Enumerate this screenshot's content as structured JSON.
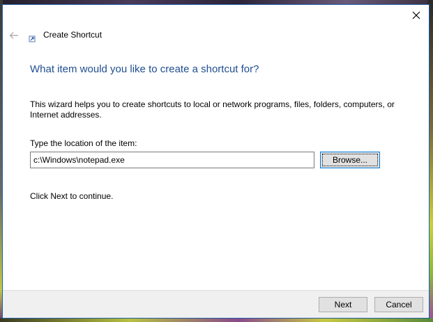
{
  "window": {
    "title": "Create Shortcut",
    "close_icon": "close-icon",
    "back_icon": "back-arrow-icon"
  },
  "main": {
    "heading": "What item would you like to create a shortcut for?",
    "description": "This wizard helps you to create shortcuts to local or network programs, files, folders, computers, or Internet addresses.",
    "location_label": "Type the location of the item:",
    "location_value": "c:\\Windows\\notepad.exe",
    "browse_label": "Browse...",
    "continue_text": "Click Next to continue."
  },
  "footer": {
    "next_label": "Next",
    "cancel_label": "Cancel"
  },
  "colors": {
    "heading": "#1f4e91",
    "window_border": "#1f5fa8",
    "focus_border": "#0078d7",
    "footer_bg": "#f0f0f0"
  }
}
